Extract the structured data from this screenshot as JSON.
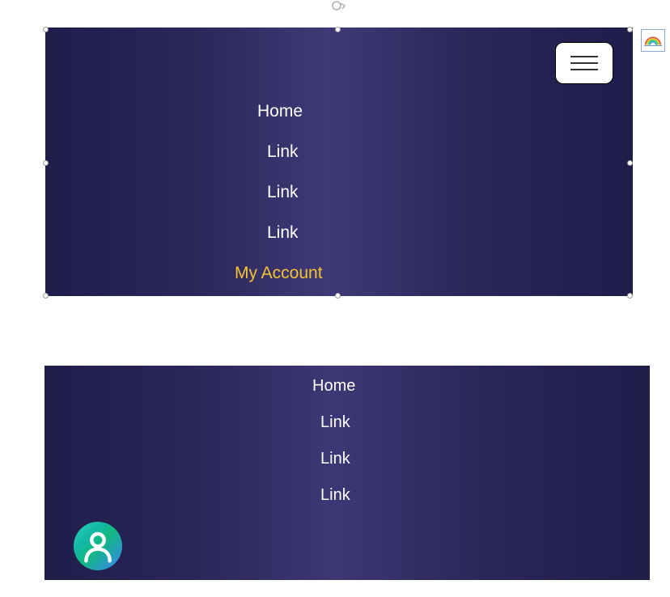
{
  "nav_top": {
    "items": [
      {
        "label": "Home"
      },
      {
        "label": "Link"
      },
      {
        "label": "Link"
      },
      {
        "label": "Link"
      },
      {
        "label": "My Account"
      }
    ]
  },
  "nav_bottom": {
    "items": [
      {
        "label": "Home"
      },
      {
        "label": "Link"
      },
      {
        "label": "Link"
      },
      {
        "label": "Link"
      }
    ]
  },
  "colors": {
    "accent": "#f4c430",
    "panel_bg": "#2a2759",
    "white": "#ffffff"
  }
}
